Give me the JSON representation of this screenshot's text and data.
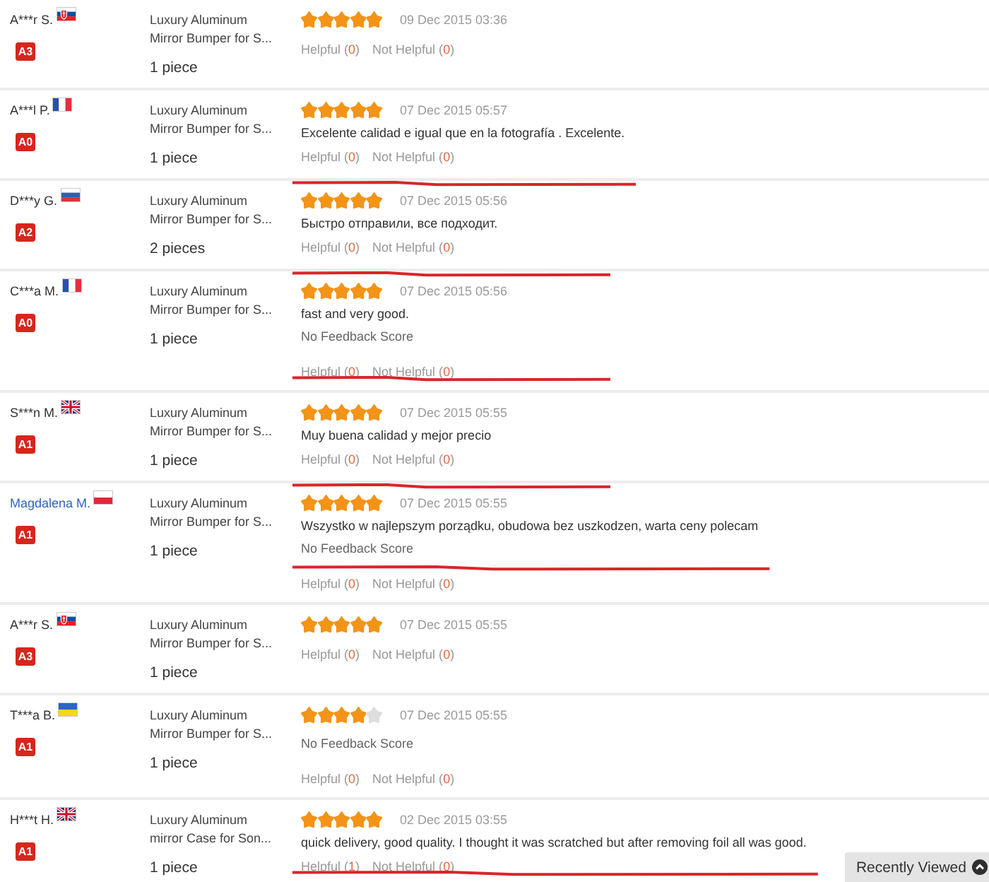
{
  "reviews": [
    {
      "reviewer": {
        "name": "A***r S.",
        "linked": false,
        "flag": {
          "kind": "slovakia"
        },
        "badge": "A3"
      },
      "product": {
        "title": "Luxury Aluminum Mirror Bumper for S...",
        "quantity": "1 piece"
      },
      "stars": 5,
      "date": "09 Dec 2015 03:36",
      "helpful": "Helpful (0)",
      "not_helpful": "Not Helpful (0)"
    },
    {
      "reviewer": {
        "name": "A***l P.",
        "linked": false,
        "flag": {
          "kind": "france"
        },
        "badge": "A0"
      },
      "product": {
        "title": "Luxury Aluminum Mirror Bumper for S...",
        "quantity": "1 piece"
      },
      "stars": 5,
      "date": "07 Dec 2015 05:57",
      "comment": "Excelente calidad e igual que en la fotografía . Excelente.",
      "helpful": "Helpful (0)",
      "not_helpful": "Not Helpful (0)",
      "underline": {
        "kind": "below_row"
      }
    },
    {
      "reviewer": {
        "name": "D***y G.",
        "linked": false,
        "flag": {
          "kind": "russia"
        },
        "badge": "A2"
      },
      "product": {
        "title": "Luxury Aluminum Mirror Bumper for S...",
        "quantity": "2 pieces"
      },
      "stars": 5,
      "date": "07 Dec 2015 05:56",
      "comment": "Быстро отправили, все подходит.",
      "helpful": "Helpful (0)",
      "not_helpful": "Not Helpful (0)",
      "underline": {
        "kind": "below_row"
      }
    },
    {
      "reviewer": {
        "name": "C***a M.",
        "linked": false,
        "flag": {
          "kind": "france"
        },
        "badge": "A0"
      },
      "product": {
        "title": "Luxury Aluminum Mirror Bumper for S...",
        "quantity": "1 piece"
      },
      "stars": 5,
      "date": "07 Dec 2015 05:56",
      "comment": "fast and very good.",
      "feedback_score": "No Feedback Score",
      "helpful": "Helpful (0)",
      "not_helpful": "Not Helpful (0)",
      "underline": {
        "kind": "below_helpful"
      }
    },
    {
      "reviewer": {
        "name": "S***n M.",
        "linked": false,
        "flag": {
          "kind": "britain"
        },
        "badge": "A1"
      },
      "product": {
        "title": "Luxury Aluminum Mirror Bumper for S...",
        "quantity": "1 piece"
      },
      "stars": 5,
      "date": "07 Dec 2015 05:55",
      "comment": "Muy buena calidad y mejor precio",
      "helpful": "Helpful (0)",
      "not_helpful": "Not Helpful (0)",
      "underline": {
        "kind": "below_row"
      }
    },
    {
      "reviewer": {
        "name": "Magdalena M.",
        "linked": true,
        "flag": {
          "kind": "poland"
        },
        "badge": "A1"
      },
      "product": {
        "title": "Luxury Aluminum Mirror Bumper for S...",
        "quantity": "1 piece"
      },
      "stars": 5,
      "date": "07 Dec 2015 05:55",
      "comment": "Wszystko w najlepszym porządku, obudowa bez uszkodzen, warta ceny polecam",
      "feedback_score": "No Feedback Score",
      "helpful": "Helpful (0)",
      "not_helpful": "Not Helpful (0)",
      "underline": {
        "kind": "below_score"
      }
    },
    {
      "reviewer": {
        "name": "A***r S.",
        "linked": false,
        "flag": {
          "kind": "slovakia"
        },
        "badge": "A3"
      },
      "product": {
        "title": "Luxury Aluminum Mirror Bumper for S...",
        "quantity": "1 piece"
      },
      "stars": 5,
      "date": "07 Dec 2015 05:55",
      "helpful": "Helpful (0)",
      "not_helpful": "Not Helpful (0)"
    },
    {
      "reviewer": {
        "name": "T***a B.",
        "linked": false,
        "flag": {
          "kind": "ukraine"
        },
        "badge": "A1"
      },
      "product": {
        "title": "Luxury Aluminum Mirror Bumper for S...",
        "quantity": "1 piece"
      },
      "stars": 4,
      "date": "07 Dec 2015 05:55",
      "feedback_score": "No Feedback Score",
      "helpful": "Helpful (0)",
      "not_helpful": "Not Helpful (0)"
    },
    {
      "reviewer": {
        "name": "H***t H.",
        "linked": false,
        "flag": {
          "kind": "britain"
        },
        "badge": "A1"
      },
      "product": {
        "title": "Luxury Aluminum mirror Case for Son...",
        "quantity": "1 piece"
      },
      "stars": 5,
      "date": "02 Dec 2015 03:55",
      "comment": "quick delivery, good quality. I thought it was scratched but after removing foil all was good.",
      "helpful": "Helpful (1)",
      "not_helpful": "Not Helpful (0)",
      "underline": {
        "kind": "below_helpful"
      }
    }
  ],
  "recently_viewed": {
    "label": "Recently Viewed"
  }
}
